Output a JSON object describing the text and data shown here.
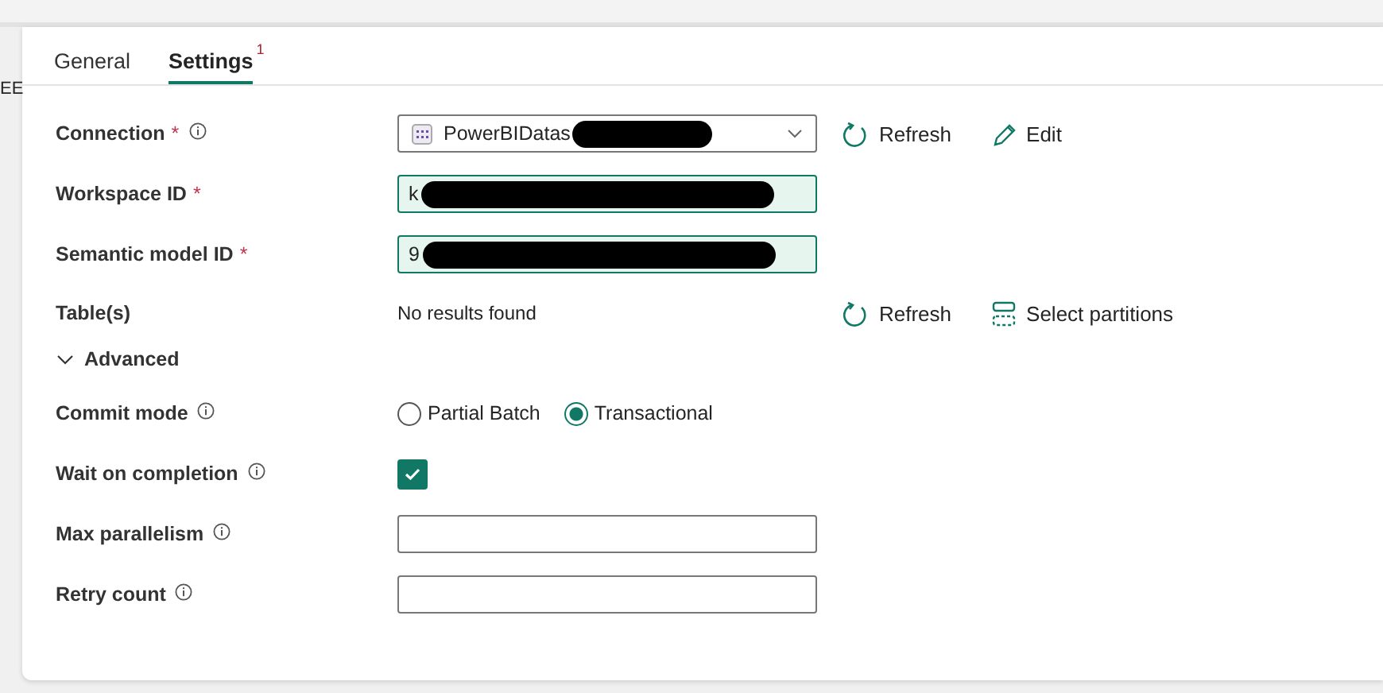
{
  "side_text": "EE",
  "tabs": [
    {
      "label": "General",
      "selected": false
    },
    {
      "label": "Settings",
      "selected": true,
      "badge": "1"
    }
  ],
  "rows": [
    {
      "kind": "dropdown",
      "label": "Connection",
      "required_mark": "*",
      "info": true,
      "value": "PowerBIDatas",
      "redacted": true,
      "actions": [
        {
          "kind": "refresh",
          "label": "Refresh"
        },
        {
          "kind": "edit",
          "label": "Edit"
        }
      ]
    },
    {
      "kind": "text",
      "label": "Workspace ID",
      "required_mark": "*",
      "value": "k",
      "filled": true,
      "redacted": true
    },
    {
      "kind": "text",
      "label": "Semantic model ID",
      "required_mark": "*",
      "value": "9",
      "filled": true,
      "redacted": true
    },
    {
      "kind": "note",
      "label": "Table(s)",
      "value": "No results found",
      "actions": [
        {
          "kind": "refresh",
          "label": "Refresh"
        },
        {
          "kind": "partitions",
          "label": "Select partitions"
        }
      ]
    },
    {
      "kind": "section",
      "label": "Advanced",
      "expanded": true
    },
    {
      "kind": "radio",
      "label": "Commit mode",
      "info": true,
      "options": [
        {
          "label": "Partial Batch",
          "selected": false
        },
        {
          "label": "Transactional",
          "selected": true
        }
      ]
    },
    {
      "kind": "checkbox",
      "label": "Wait on completion",
      "info": true,
      "checked": true
    },
    {
      "kind": "wide",
      "label": "Max parallelism",
      "info": true
    },
    {
      "kind": "wide",
      "label": "Retry count",
      "info": true
    }
  ]
}
